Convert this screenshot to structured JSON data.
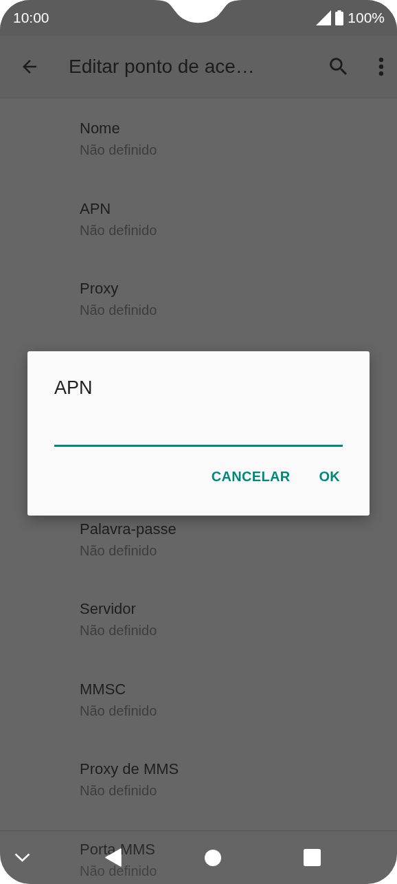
{
  "status_bar": {
    "time": "10:00",
    "battery": "100%"
  },
  "app_bar": {
    "title": "Editar ponto de ace…"
  },
  "settings_above": [
    {
      "title": "Nome",
      "value": "Não definido"
    },
    {
      "title": "APN",
      "value": "Não definido"
    },
    {
      "title": "Proxy",
      "value": "Não definido"
    }
  ],
  "settings_below": [
    {
      "title": "Palavra-passe",
      "value": "Não definido"
    },
    {
      "title": "Servidor",
      "value": "Não definido"
    },
    {
      "title": "MMSC",
      "value": "Não definido"
    },
    {
      "title": "Proxy de MMS",
      "value": "Não definido"
    },
    {
      "title": "Porta MMS",
      "value": "Não definido"
    }
  ],
  "dialog": {
    "title": "APN",
    "buttons": [
      "CANCELAR",
      "OK"
    ]
  }
}
